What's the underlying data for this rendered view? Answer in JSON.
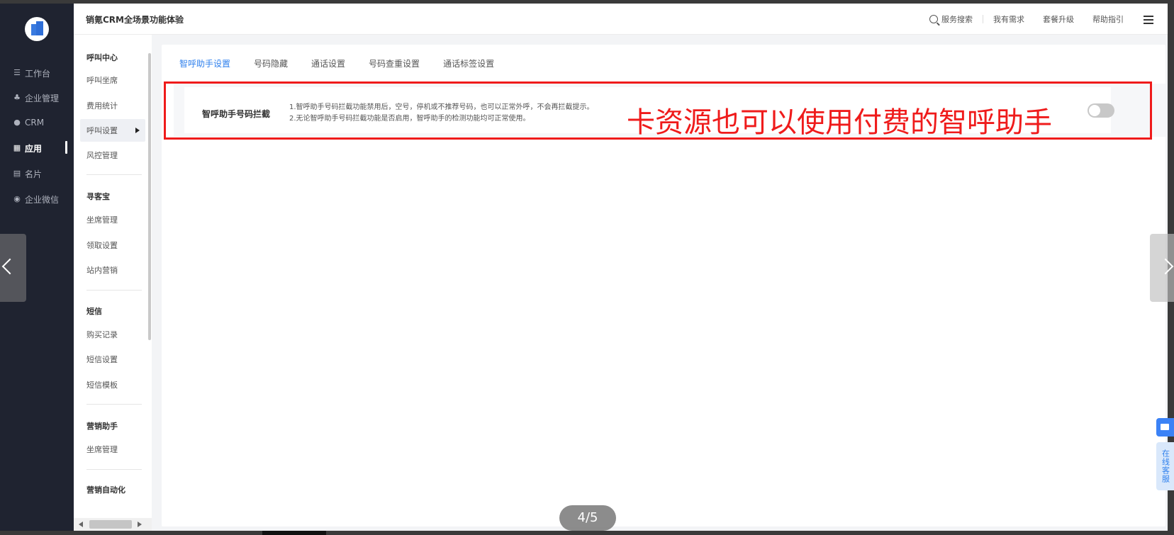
{
  "app": {
    "title": "销氪CRM全场景功能体验"
  },
  "topbar": {
    "search": "服务搜索",
    "demand": "我有需求",
    "upgrade": "套餐升级",
    "help": "帮助指引"
  },
  "leftnav": {
    "items": [
      {
        "label": "工作台",
        "icon": "list-icon"
      },
      {
        "label": "企业管理",
        "icon": "org-icon"
      },
      {
        "label": "CRM",
        "icon": "crm-icon"
      },
      {
        "label": "应用",
        "icon": "apps-icon",
        "active": true
      },
      {
        "label": "名片",
        "icon": "card-icon"
      },
      {
        "label": "企业微信",
        "icon": "wechat-icon"
      }
    ]
  },
  "submenu": {
    "groups": [
      {
        "title": "呼叫中心",
        "items": [
          "呼叫坐席",
          "费用统计",
          "呼叫设置",
          "风控管理"
        ]
      },
      {
        "title": "寻客宝",
        "items": [
          "坐席管理",
          "领取设置",
          "站内营销"
        ]
      },
      {
        "title": "短信",
        "items": [
          "购买记录",
          "短信设置",
          "短信模板"
        ]
      },
      {
        "title": "营销助手",
        "items": [
          "坐席管理"
        ]
      },
      {
        "title": "营销自动化",
        "items": []
      }
    ],
    "active_item": "呼叫设置"
  },
  "main": {
    "tabs": [
      "智呼助手设置",
      "号码隐藏",
      "通话设置",
      "号码查重设置",
      "通话标签设置"
    ],
    "active_tab": "智呼助手设置",
    "setting": {
      "label": "智呼助手号码拦截",
      "desc_line1": "1.智呼助手号码拦截功能禁用后，空号，停机或不推荐号码，也可以正常外呼，不会再拦截提示。",
      "desc_line2": "2.无论智呼助手号码拦截功能是否启用，智呼助手的检测功能均可正常使用。",
      "enabled": false
    }
  },
  "annotation": {
    "text": "卡资源也可以使用付费的智呼助手",
    "color": "#ef1b1b"
  },
  "viewer": {
    "counter": "4/5"
  },
  "support": {
    "label": "在线客服"
  }
}
